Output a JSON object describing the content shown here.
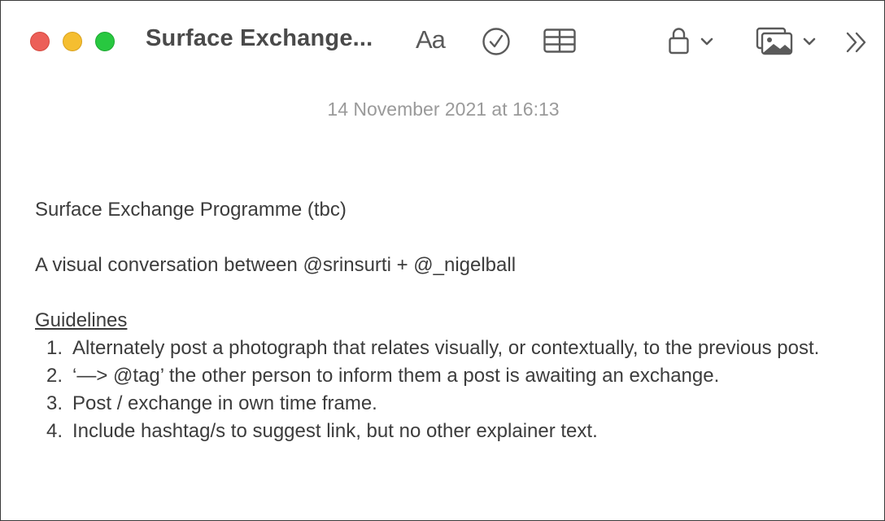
{
  "window": {
    "title": "Surface Exchange..."
  },
  "toolbar": {
    "font_icon_label": "Aa",
    "icons": [
      "close-traffic-light",
      "minimize-traffic-light",
      "zoom-traffic-light",
      "font-format-icon",
      "checklist-icon",
      "table-icon",
      "lock-icon",
      "chevron-down-icon",
      "media-icon",
      "chevron-down-icon",
      "more-chevrons-icon"
    ],
    "colors": {
      "close": "#ec5f58",
      "minimize": "#f5be30",
      "zoom": "#28c840"
    }
  },
  "note": {
    "timestamp": "14 November 2021 at 16:13",
    "title_line": "Surface Exchange Programme (tbc)",
    "subtitle_line": "A visual conversation between @srinsurti + @_nigelball",
    "guidelines_heading": "Guidelines",
    "guidelines": [
      {
        "num": "1.",
        "text": "Alternately post a photograph that relates visually, or contextually, to the previous post."
      },
      {
        "num": "2.",
        "text": "‘—> @tag’ the other person to inform them a post is awaiting an exchange."
      },
      {
        "num": "3.",
        "text": "Post / exchange in own time frame."
      },
      {
        "num": "4.",
        "text": "Include hashtag/s to suggest link, but no other explainer text."
      }
    ]
  }
}
